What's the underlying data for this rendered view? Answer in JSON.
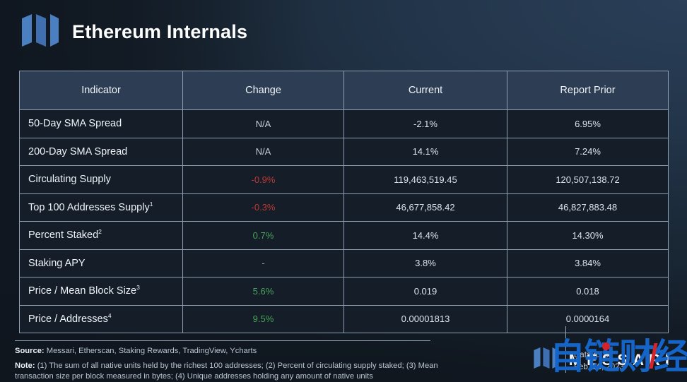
{
  "header": {
    "title": "Ethereum Internals",
    "logo_alt": "messari-logo"
  },
  "table": {
    "columns": [
      "Indicator",
      "Change",
      "Current",
      "Report Prior"
    ],
    "rows": [
      {
        "indicator": "50-Day SMA Spread",
        "footnote": "",
        "change": "N/A",
        "change_dir": "na",
        "current": "-2.1%",
        "prior": "6.95%"
      },
      {
        "indicator": "200-Day SMA Spread",
        "footnote": "",
        "change": "N/A",
        "change_dir": "na",
        "current": "14.1%",
        "prior": "7.24%"
      },
      {
        "indicator": "Circulating Supply",
        "footnote": "",
        "change": "-0.9%",
        "change_dir": "down",
        "current": "119,463,519.45",
        "prior": "120,507,138.72"
      },
      {
        "indicator": "Top 100 Addresses Supply",
        "footnote": "1",
        "change": "-0.3%",
        "change_dir": "down",
        "current": "46,677,858.42",
        "prior": "46,827,883.48"
      },
      {
        "indicator": "Percent Staked",
        "footnote": "2",
        "change": "0.7%",
        "change_dir": "up",
        "current": "14.4%",
        "prior": "14.30%"
      },
      {
        "indicator": "Staking APY",
        "footnote": "",
        "change": "-",
        "change_dir": "dash",
        "current": "3.8%",
        "prior": "3.84%"
      },
      {
        "indicator": "Price / Mean Block Size",
        "footnote": "3",
        "change": "5.6%",
        "change_dir": "up",
        "current": "0.019",
        "prior": "0.018"
      },
      {
        "indicator": "Price / Addresses",
        "footnote": "4",
        "change": "9.5%",
        "change_dir": "up",
        "current": "0.00001813",
        "prior": "0.0000164"
      }
    ]
  },
  "footer": {
    "source_label": "Source:",
    "source_text": "Messari, Etherscan, Staking Rewards, TradingView, Ycharts",
    "note_label": "Note:",
    "note_text": "(1) The sum of all native units held by the richest 100 addresses; (2) Percent of circulating supply staked; (3) Mean transaction size per block measured in bytes; (4) Unique addresses holding any amount of native units",
    "brand_word": "MESSARI",
    "date_label": "Data as of",
    "date_value": "Feb. 16, 2023",
    "watermark": "自链财经"
  },
  "colors": {
    "accent_blue": "#4a7fc1",
    "positive_green": "#49a35a",
    "negative_red": "#c0392f",
    "header_row_bg": "#2c3d54",
    "body_row_bg": "#141d28",
    "watermark_blue": "#1565c8"
  }
}
